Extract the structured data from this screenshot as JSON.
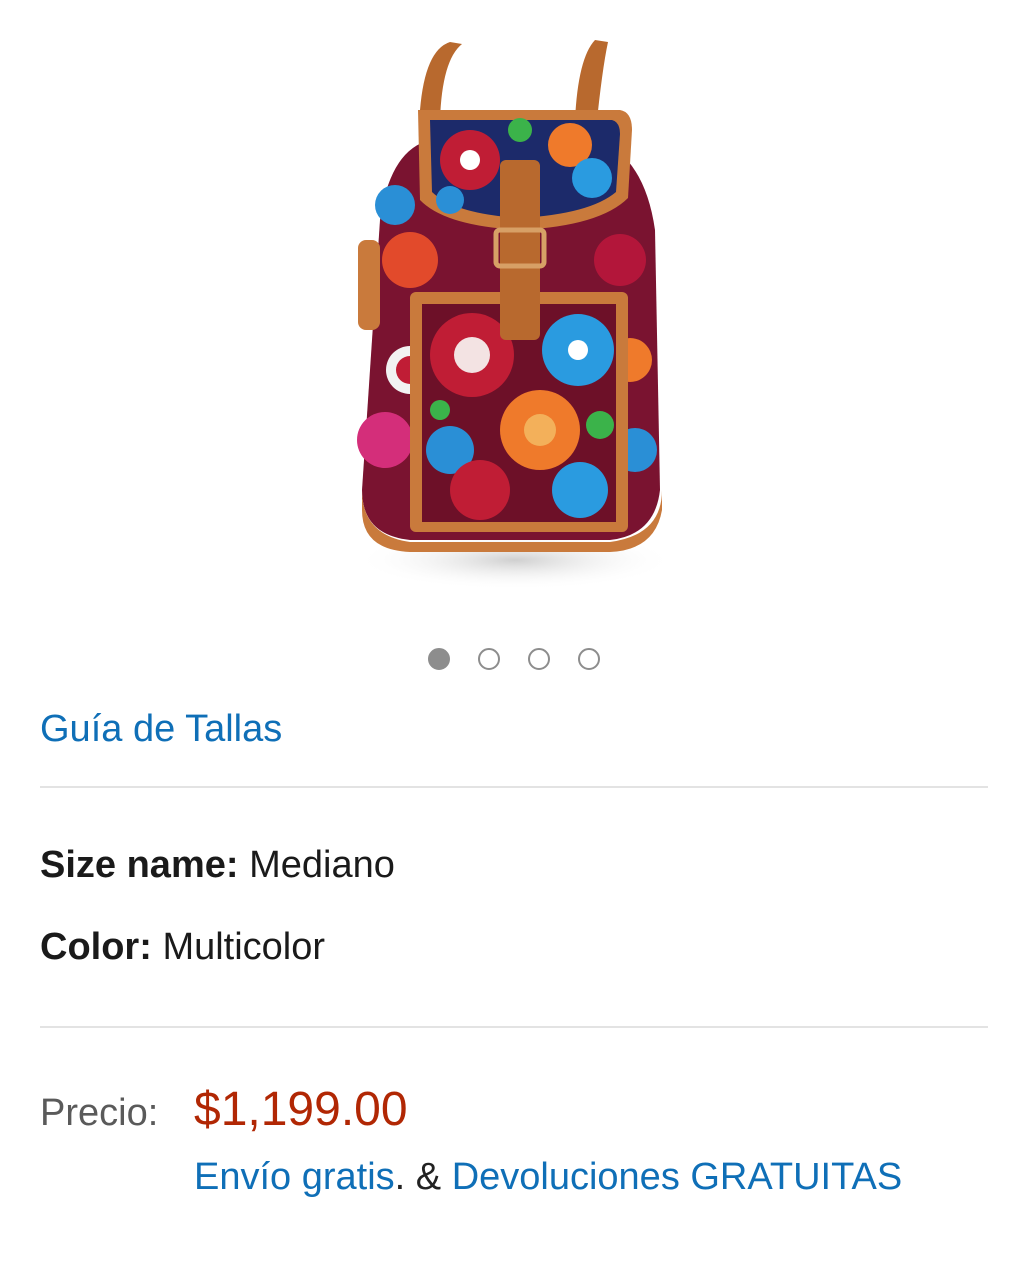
{
  "carousel": {
    "image_alt": "Backpack with floral embroidery",
    "dots": [
      {
        "active": true
      },
      {
        "active": false
      },
      {
        "active": false
      },
      {
        "active": false
      }
    ]
  },
  "size_guide_link": "Guía de Tallas",
  "specs": {
    "size_label": "Size name:",
    "size_value": "Mediano",
    "color_label": "Color:",
    "color_value": "Multicolor"
  },
  "price": {
    "label": "Precio:",
    "value": "$1,199.00"
  },
  "shipping": {
    "free_shipping": "Envío gratis",
    "dot": ".",
    "ampersand": " & ",
    "free_returns": "Devoluciones GRATUITAS"
  },
  "colors": {
    "link": "#0f6fb7",
    "price": "#b12704",
    "leather": "#c97a3c"
  }
}
